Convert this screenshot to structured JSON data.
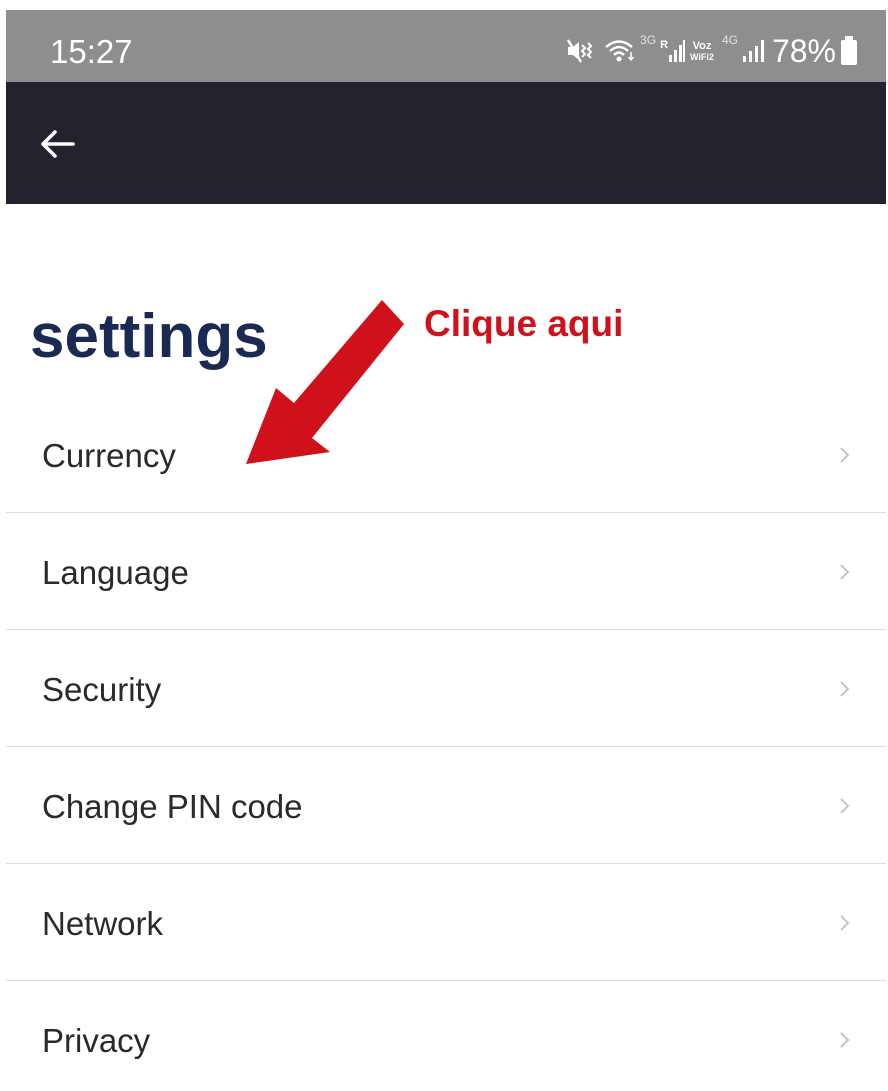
{
  "status_bar": {
    "time": "15:27",
    "network_3g": "3G",
    "roaming": "R",
    "voz_top": "Voz",
    "voz_bottom": "WiFi2",
    "network_4g": "4G",
    "battery": "78%",
    "icons": [
      "mute-vibrate-icon",
      "wifi-icon",
      "signal-icon",
      "battery-icon"
    ]
  },
  "app_bar": {
    "back_icon": "arrow-left-icon"
  },
  "page": {
    "title": "settings"
  },
  "annotation": {
    "text": "Clique aqui",
    "color": "#d0111b"
  },
  "settings": {
    "items": [
      {
        "label": "Currency"
      },
      {
        "label": "Language"
      },
      {
        "label": "Security"
      },
      {
        "label": "Change PIN code"
      },
      {
        "label": "Network"
      },
      {
        "label": "Privacy"
      }
    ]
  },
  "colors": {
    "status_bar": "#8e8e8e",
    "app_bar": "#23232e",
    "title": "#1b2a52",
    "divider": "#dedede"
  }
}
